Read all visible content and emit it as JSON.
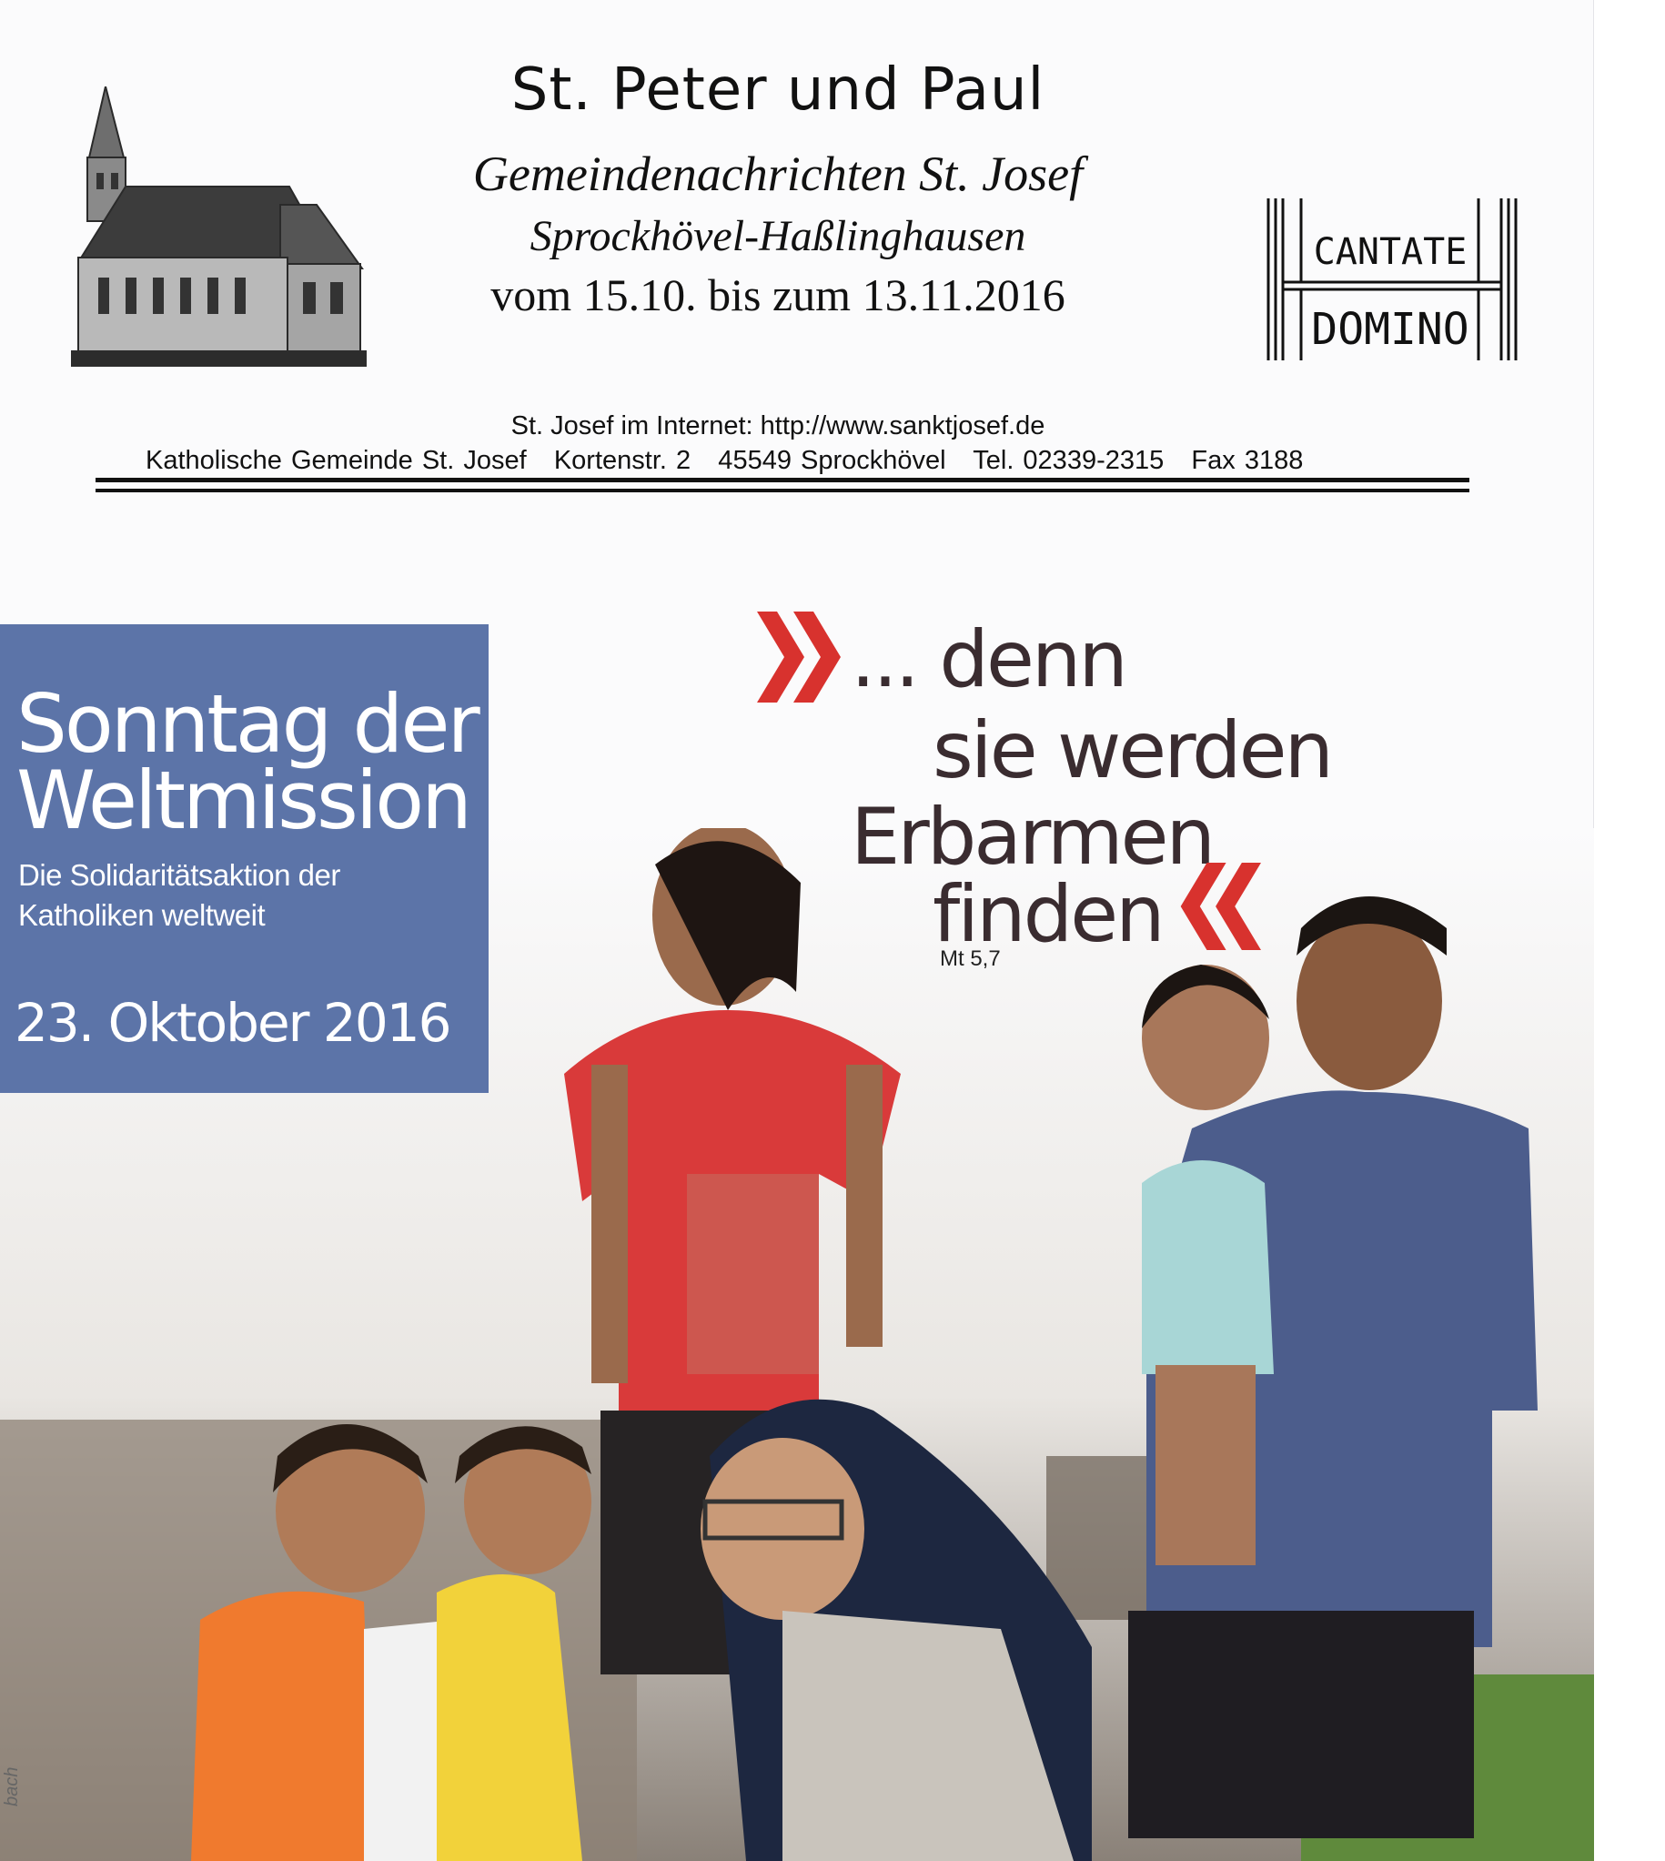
{
  "header": {
    "parish_name": "St. Peter und Paul",
    "newsletter_title": "Gemeindenachrichten St. Josef",
    "location": "Sprockhövel-Haßlinghausen",
    "date_range": "vom 15.10. bis zum 13.11.2016",
    "stamp_line1": "CANTATE",
    "stamp_line2": "DOMINO"
  },
  "contact": {
    "internet": "St. Josef im Internet: http://www.sanktjosef.de",
    "address_line": "Katholische Gemeinde St. Josef   Kortenstr. 2   45549 Sprockhövel   Tel. 02339-2315   Fax 3188"
  },
  "campaign": {
    "title_line1": "Sonntag der",
    "title_line2": "Weltmission",
    "subtitle_line1": "Die Solidaritätsaktion der",
    "subtitle_line2": "Katholiken weltweit",
    "date": "23. Oktober 2016"
  },
  "quote": {
    "line1": "... denn",
    "line2": "sie werden",
    "line3": "Erbarmen",
    "line4": "finden",
    "reference": "Mt 5,7",
    "accent_color": "#d8322e"
  },
  "photo_credit": "bach"
}
